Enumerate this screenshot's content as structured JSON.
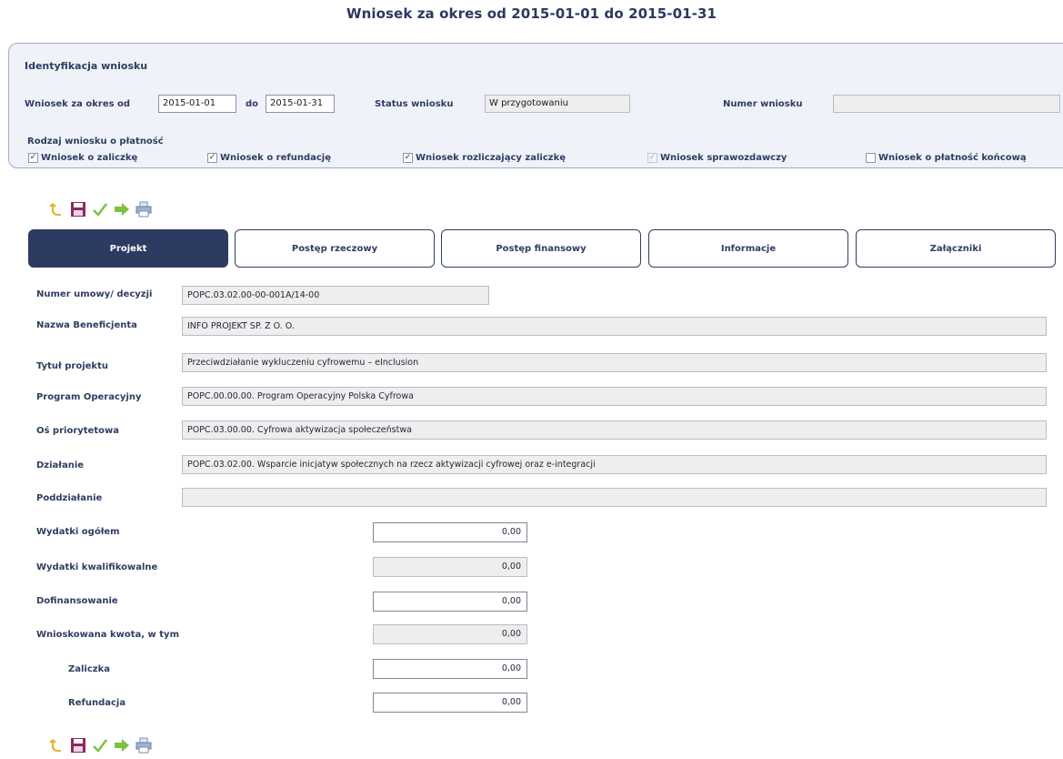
{
  "page_title": "Wniosek za okres od 2015-01-01 do 2015-01-31",
  "identification": {
    "heading": "Identyfikacja wniosku",
    "period_label": "Wniosek za okres od",
    "period_from": "2015-01-01",
    "to_label": "do",
    "period_to": "2015-01-31",
    "status_label": "Status wniosku",
    "status_value": "W przygotowaniu",
    "number_label": "Numer wniosku",
    "number_value": "",
    "type_label": "Rodzaj wniosku o płatność",
    "types": [
      {
        "label": "Wniosek o zaliczkę",
        "checked": true,
        "disabled": false
      },
      {
        "label": "Wniosek o refundację",
        "checked": true,
        "disabled": false
      },
      {
        "label": "Wniosek rozliczający zaliczkę",
        "checked": true,
        "disabled": false
      },
      {
        "label": "Wniosek sprawozdawczy",
        "checked": true,
        "disabled": true
      },
      {
        "label": "Wniosek o płatność końcową",
        "checked": false,
        "disabled": false
      }
    ]
  },
  "toolbar": {
    "icons": [
      "undo-icon",
      "save-icon",
      "check-icon",
      "send-icon",
      "print-icon"
    ]
  },
  "tabs": [
    {
      "label": "Projekt",
      "active": true
    },
    {
      "label": "Postęp rzeczowy",
      "active": false
    },
    {
      "label": "Postęp finansowy",
      "active": false
    },
    {
      "label": "Informacje",
      "active": false
    },
    {
      "label": "Załączniki",
      "active": false
    }
  ],
  "project": {
    "contract_label": "Numer umowy/ decyzji",
    "contract_value": "POPC.03.02.00-00-001A/14-00",
    "beneficiary_label": "Nazwa Beneficjenta",
    "beneficiary_value": "INFO PROJEKT SP. Z O. O.",
    "title_label": "Tytuł projektu",
    "title_value": "Przeciwdziałanie wykluczeniu cyfrowemu – eInclusion",
    "program_label": "Program Operacyjny",
    "program_value": "POPC.00.00.00. Program Operacyjny Polska Cyfrowa",
    "axis_label": "Oś priorytetowa",
    "axis_value": "POPC.03.00.00. Cyfrowa aktywizacja społeczeństwa",
    "measure_label": "Działanie",
    "measure_value": "POPC.03.02.00. Wsparcie inicjatyw społecznych na rzecz aktywizacji cyfrowej oraz e-integracji",
    "submeasure_label": "Poddziałanie",
    "submeasure_value": ""
  },
  "finance": {
    "total_label": "Wydatki ogółem",
    "total_value": "0,00",
    "eligible_label": "Wydatki kwalifikowalne",
    "eligible_value": "0,00",
    "cofinancing_label": "Dofinansowanie",
    "cofinancing_value": "0,00",
    "requested_label": "Wnioskowana kwota, w tym",
    "requested_value": "0,00",
    "advance_label": "Zaliczka",
    "advance_value": "0,00",
    "refund_label": "Refundacja",
    "refund_value": "0,00"
  }
}
